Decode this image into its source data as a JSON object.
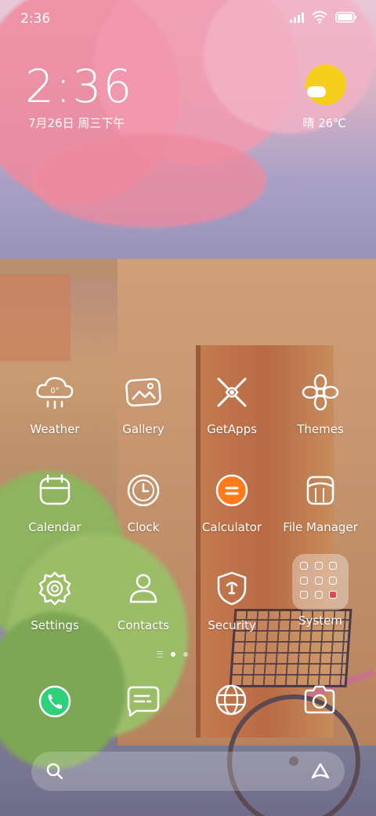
{
  "status_bar": {
    "time": "2:36",
    "icons": [
      "signal-icon",
      "wifi-icon",
      "battery-icon"
    ]
  },
  "clock_widget": {
    "time": "2:36",
    "date": "7月26日 周三下午"
  },
  "weather_widget": {
    "text": "晴 26℃",
    "icon": "sunny-cloud-icon",
    "sun_color": "#f6cf1c"
  },
  "apps": [
    {
      "label": "Weather",
      "icon": "weather-icon"
    },
    {
      "label": "Gallery",
      "icon": "gallery-icon"
    },
    {
      "label": "GetApps",
      "icon": "getapps-icon"
    },
    {
      "label": "Themes",
      "icon": "themes-icon"
    },
    {
      "label": "Calendar",
      "icon": "calendar-icon"
    },
    {
      "label": "Clock",
      "icon": "clock-icon"
    },
    {
      "label": "Calculator",
      "icon": "calculator-icon"
    },
    {
      "label": "File Manager",
      "icon": "file-manager-icon"
    },
    {
      "label": "Settings",
      "icon": "settings-icon"
    },
    {
      "label": "Contacts",
      "icon": "contacts-icon"
    },
    {
      "label": "Security",
      "icon": "security-icon"
    },
    {
      "label": "System",
      "icon": "system-folder-icon"
    }
  ],
  "weather_icon_text": "0°",
  "pager": {
    "pages": 2,
    "active": 1
  },
  "dock": [
    {
      "name": "phone-icon",
      "color": "#2fd07a"
    },
    {
      "name": "messages-icon"
    },
    {
      "name": "browser-icon"
    },
    {
      "name": "camera-icon"
    }
  ],
  "search": {
    "icon": "search-icon",
    "assistant_icon": "assistant-icon"
  },
  "colors": {
    "calculator": "#ff7a1a",
    "phone": "#2fd07a"
  }
}
